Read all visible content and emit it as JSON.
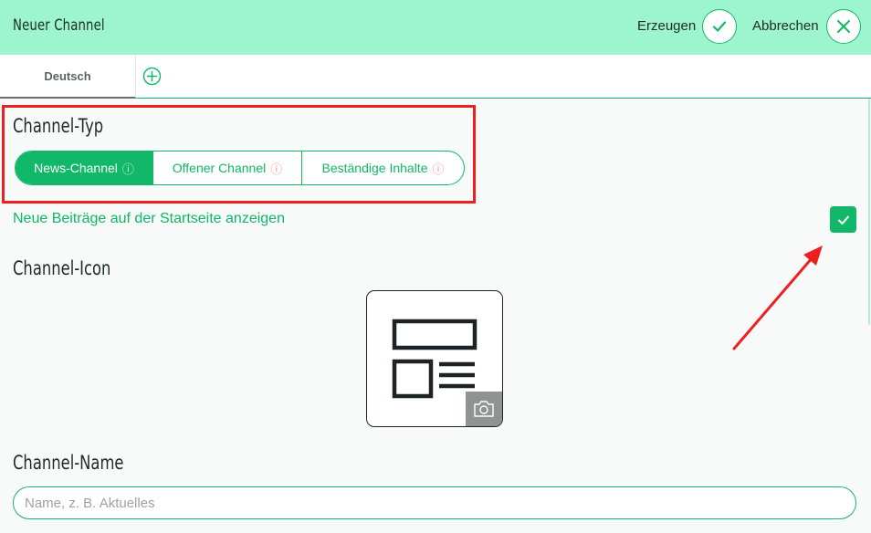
{
  "header": {
    "title": "Neuer Channel",
    "create_label": "Erzeugen",
    "cancel_label": "Abbrechen",
    "create_icon": "check-icon",
    "cancel_icon": "close-icon"
  },
  "tabs": {
    "items": [
      {
        "label": "Deutsch",
        "active": true
      }
    ],
    "add_icon": "plus-circle-icon"
  },
  "channel_type": {
    "heading": "Channel-Typ",
    "options": [
      {
        "label": "News-Channel",
        "info": "ⓘ",
        "selected": true
      },
      {
        "label": "Offener Channel",
        "info": "ⓘ",
        "selected": false
      },
      {
        "label": "Beständige Inhalte",
        "info": "ⓘ",
        "selected": false
      }
    ]
  },
  "show_on_start": {
    "label": "Neue Beiträge auf der Startseite anzeigen",
    "checked": true
  },
  "channel_icon": {
    "heading": "Channel-Icon",
    "icon": "news-layout-icon",
    "camera_icon": "camera-icon"
  },
  "channel_name": {
    "heading": "Channel-Name",
    "placeholder": "Name, z. B. Aktuelles",
    "value": ""
  },
  "colors": {
    "accent": "#10b868",
    "header_bg": "#9cf5cf",
    "highlight": "#ee1f1f"
  }
}
